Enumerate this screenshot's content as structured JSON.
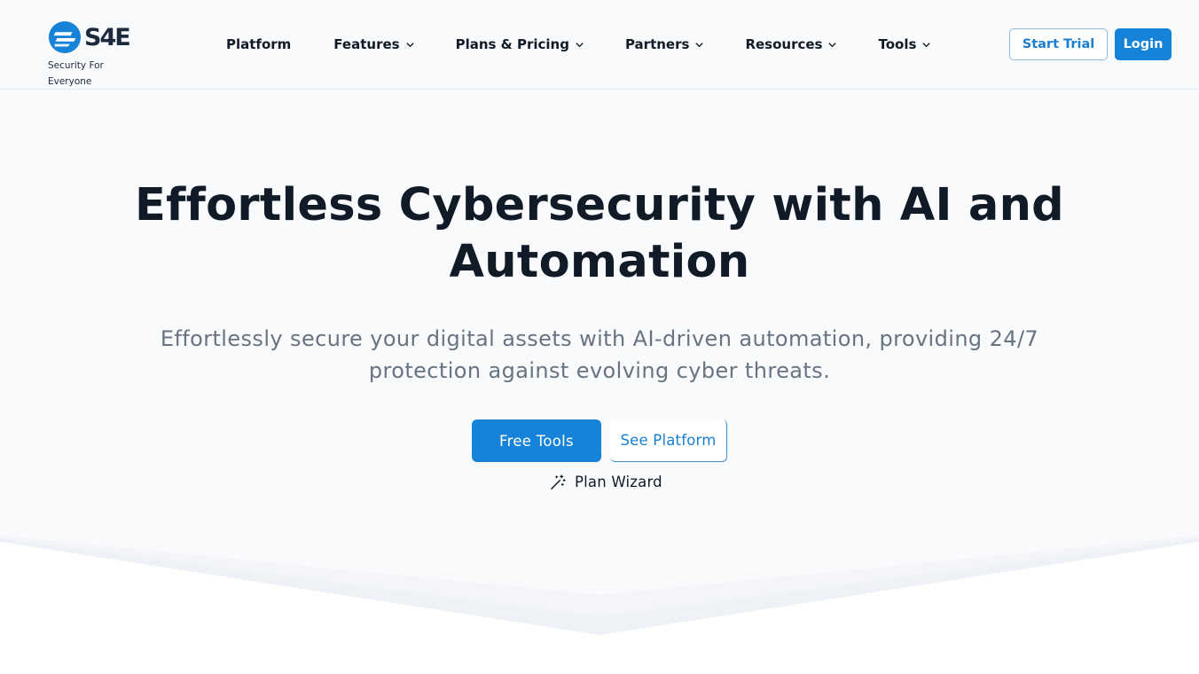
{
  "brand": {
    "name": "S4E",
    "tagline": "Security For Everyone",
    "colors": {
      "primary": "#1683d8",
      "dark": "#1b2a3d"
    }
  },
  "nav": {
    "items": [
      {
        "label": "Platform",
        "has_dropdown": false
      },
      {
        "label": "Features",
        "has_dropdown": true
      },
      {
        "label": "Plans & Pricing",
        "has_dropdown": true
      },
      {
        "label": "Partners",
        "has_dropdown": true
      },
      {
        "label": "Resources",
        "has_dropdown": true
      },
      {
        "label": "Tools",
        "has_dropdown": true
      }
    ],
    "start_trial_label": "Start Trial",
    "login_label": "Login"
  },
  "hero": {
    "title": "Effortless Cybersecurity with AI and Automation",
    "subtitle": "Effortlessly secure your digital assets with AI-driven automation, providing 24/7 protection against evolving cyber threats.",
    "primary_button": "Free Tools",
    "secondary_button": "See Platform",
    "wizard_label": "Plan Wizard",
    "wizard_icon": "magic-wand-icon"
  }
}
